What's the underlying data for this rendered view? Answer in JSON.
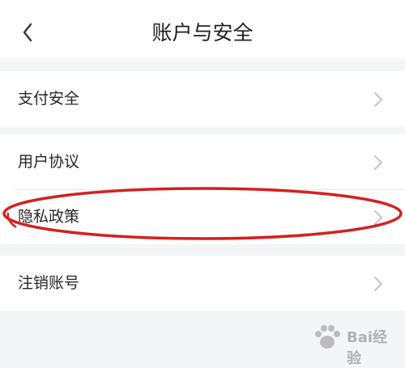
{
  "header": {
    "title": "账户与安全",
    "back_icon": "chevron-left-icon"
  },
  "groups": [
    {
      "items": [
        {
          "label": "支付安全"
        }
      ]
    },
    {
      "items": [
        {
          "label": "用户协议"
        },
        {
          "label": "隐私政策"
        }
      ]
    },
    {
      "items": [
        {
          "label": "注销账号"
        }
      ]
    }
  ],
  "annotation": {
    "highlight_color": "#d42020",
    "target": "隐私政策"
  },
  "watermark": {
    "text": "Bai经验",
    "icon": "paw-icon"
  },
  "colors": {
    "background": "#f4f5f7",
    "surface": "#ffffff",
    "text": "#262626",
    "chevron": "#c4c4c4"
  }
}
